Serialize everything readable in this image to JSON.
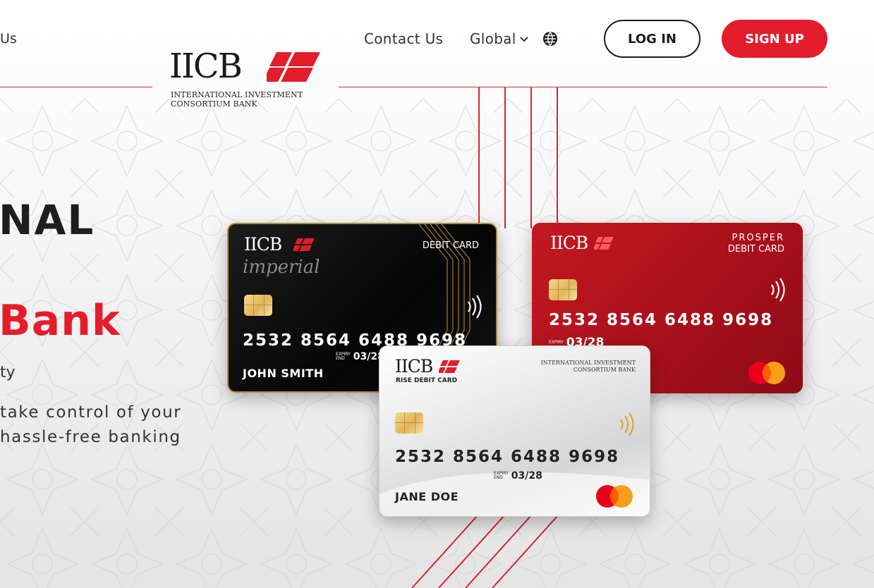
{
  "header": {
    "cut_nav_text": "Us",
    "contact_label": "Contact Us",
    "global_label": "Global",
    "login_label": "LOG IN",
    "signup_label": "SIGN UP"
  },
  "logo": {
    "wordmark": "IICB",
    "subtitle_line1": "INTERNATIONAL INVESTMENT",
    "subtitle_line2": "CONSORTIUM BANK"
  },
  "hero": {
    "line1": "NAL",
    "line2": "Bank",
    "line3": "ty",
    "line4a": "take control of your",
    "line4b": "hassle-free banking"
  },
  "cards": {
    "black": {
      "logo": "IICB",
      "script": "imperial",
      "type": "DEBIT CARD",
      "number": "2532  8564  6488  9698",
      "expiry_label_1": "EXPIRY",
      "expiry_label_2": "END",
      "expiry": "03/28",
      "name": "JOHN SMITH"
    },
    "red": {
      "logo": "IICB",
      "type_line1": "PROSPER",
      "type_line2": "DEBIT CARD",
      "number": "2532  8564  6488  9698",
      "expiry_label_1": "EXPIRY",
      "expiry": "03/28"
    },
    "silver": {
      "logo": "IICB",
      "subtitle": "RISE DEBIT CARD",
      "bank_line1": "INTERNATIONAL INVESTMENT",
      "bank_line2": "CONSORTIUM BANK",
      "number": "2532  8564  6488  9698",
      "expiry_label_1": "EXPIRY",
      "expiry_label_2": "END",
      "expiry": "03/28",
      "name": "JANE DOE"
    }
  },
  "colors": {
    "brand_red": "#e31d2b",
    "dark": "#1a1a1a",
    "gold": "#b08a3e"
  },
  "icons": [
    "chevron-down-icon",
    "globe-icon",
    "nfc-icon",
    "mastercard-icon"
  ]
}
